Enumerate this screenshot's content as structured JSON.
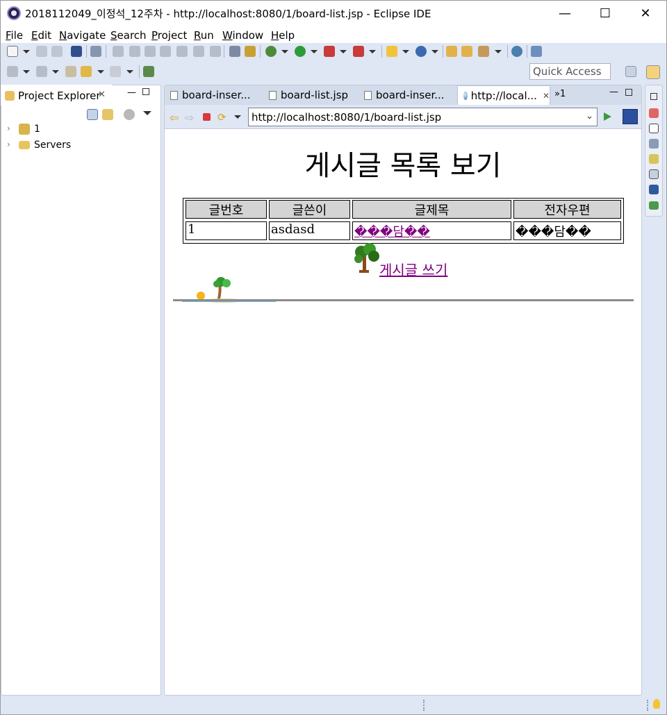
{
  "window": {
    "title": "2018112049_이정석_12주차 - http://localhost:8080/1/board-list.jsp - Eclipse IDE",
    "minimize": "—",
    "maximize": "☐",
    "close": "✕"
  },
  "menu": [
    "File",
    "Edit",
    "Navigate",
    "Search",
    "Project",
    "Run",
    "Window",
    "Help"
  ],
  "toolbar": {
    "quick_access_placeholder": "Quick Access"
  },
  "explorer": {
    "title": "Project Explorer",
    "tree": [
      {
        "label": "1",
        "icon": "project-icon"
      },
      {
        "label": "Servers",
        "icon": "folder-icon"
      }
    ]
  },
  "editor": {
    "tabs": [
      {
        "label": "board-inser...",
        "icon": "jsp-file-icon",
        "active": false
      },
      {
        "label": "board-list.jsp",
        "icon": "jsp-file-icon",
        "active": false
      },
      {
        "label": "board-inser...",
        "icon": "jsp-file-icon",
        "active": false
      },
      {
        "label": "http://local...",
        "icon": "globe-icon",
        "active": true
      }
    ],
    "overflow_count": "»1",
    "url": "http://localhost:8080/1/board-list.jsp"
  },
  "page": {
    "title": "게시글 목록 보기",
    "table": {
      "headers": [
        "글번호",
        "글쓴이",
        "글제목",
        "전자우편"
      ],
      "rows": [
        [
          "1",
          "asdasd",
          "���담��",
          "���담��"
        ]
      ]
    },
    "write_link": "게시글 쓰기"
  },
  "colors": {
    "workbench_bg": "#dfe6f4",
    "link_visited": "#800080",
    "header_cell": "#d4d4d4"
  }
}
